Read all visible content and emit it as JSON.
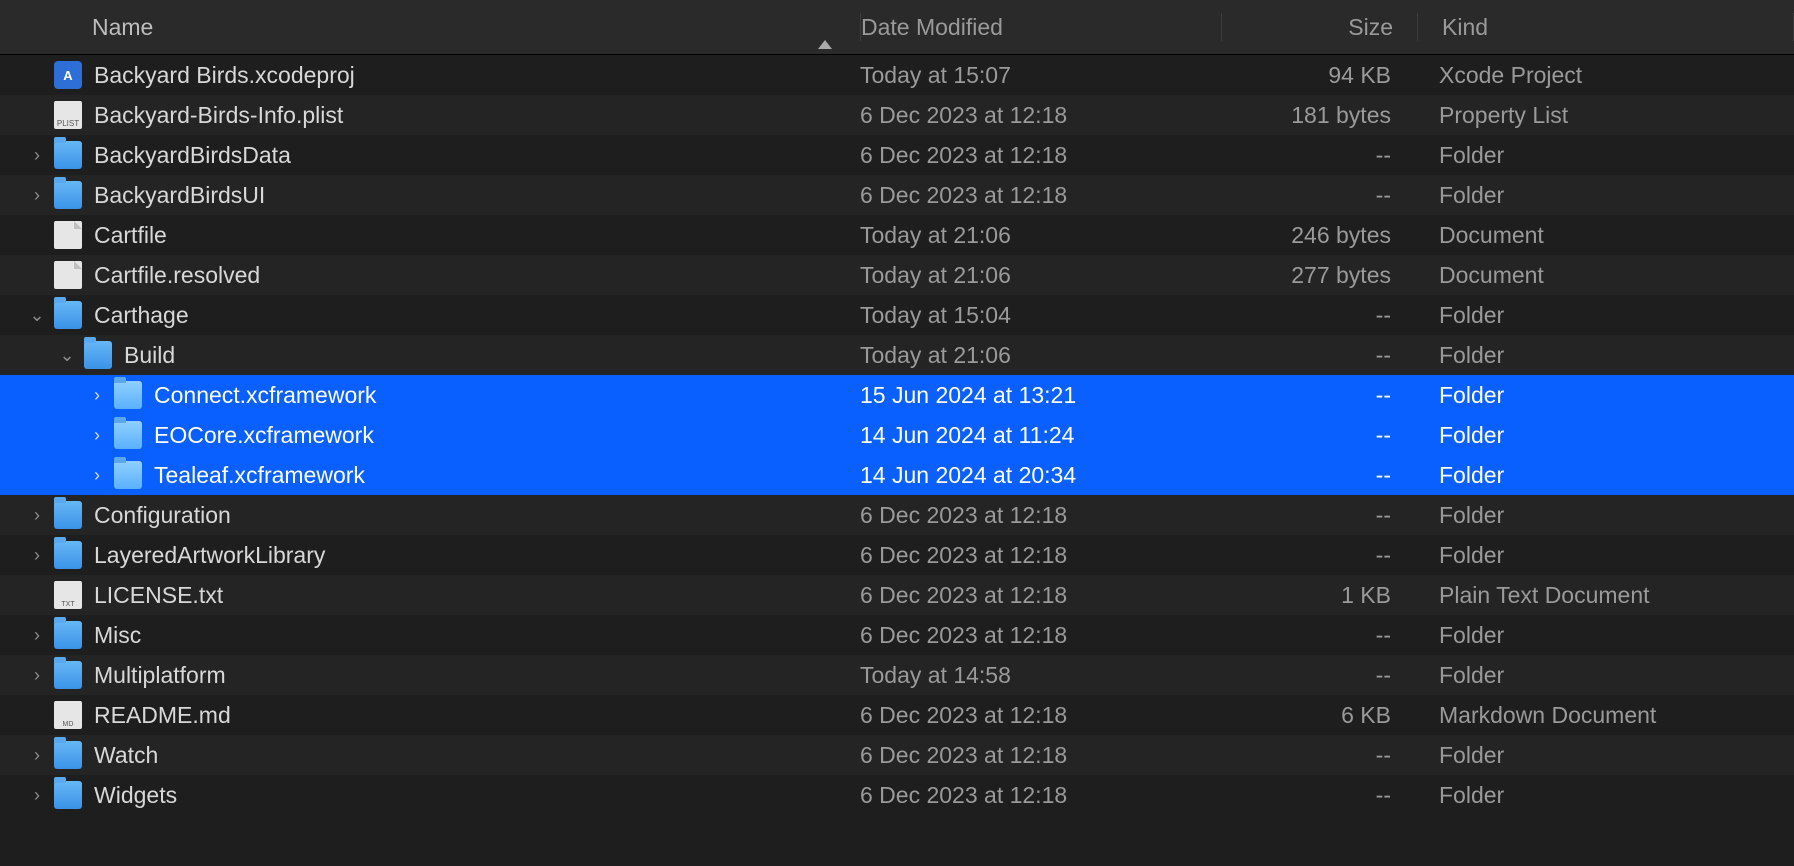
{
  "columns": {
    "name": "Name",
    "date": "Date Modified",
    "size": "Size",
    "kind": "Kind"
  },
  "rows": [
    {
      "indent": 0,
      "disclose": "none",
      "icon": "xcode",
      "name": "Backyard Birds.xcodeproj",
      "date": "Today at 15:07",
      "size": "94 KB",
      "kind": "Xcode Project",
      "selected": false
    },
    {
      "indent": 0,
      "disclose": "none",
      "icon": "plist",
      "name": "Backyard-Birds-Info.plist",
      "date": "6 Dec 2023 at 12:18",
      "size": "181 bytes",
      "kind": "Property List",
      "selected": false
    },
    {
      "indent": 0,
      "disclose": "right",
      "icon": "folder",
      "name": "BackyardBirdsData",
      "date": "6 Dec 2023 at 12:18",
      "size": "--",
      "kind": "Folder",
      "selected": false
    },
    {
      "indent": 0,
      "disclose": "right",
      "icon": "folder",
      "name": "BackyardBirdsUI",
      "date": "6 Dec 2023 at 12:18",
      "size": "--",
      "kind": "Folder",
      "selected": false
    },
    {
      "indent": 0,
      "disclose": "none",
      "icon": "file",
      "name": "Cartfile",
      "date": "Today at 21:06",
      "size": "246 bytes",
      "kind": "Document",
      "selected": false
    },
    {
      "indent": 0,
      "disclose": "none",
      "icon": "file",
      "name": "Cartfile.resolved",
      "date": "Today at 21:06",
      "size": "277 bytes",
      "kind": "Document",
      "selected": false
    },
    {
      "indent": 0,
      "disclose": "down",
      "icon": "folder",
      "name": "Carthage",
      "date": "Today at 15:04",
      "size": "--",
      "kind": "Folder",
      "selected": false
    },
    {
      "indent": 1,
      "disclose": "down",
      "icon": "folder",
      "name": "Build",
      "date": "Today at 21:06",
      "size": "--",
      "kind": "Folder",
      "selected": false
    },
    {
      "indent": 2,
      "disclose": "right",
      "icon": "folder",
      "name": "Connect.xcframework",
      "date": "15 Jun 2024 at 13:21",
      "size": "--",
      "kind": "Folder",
      "selected": true
    },
    {
      "indent": 2,
      "disclose": "right",
      "icon": "folder",
      "name": "EOCore.xcframework",
      "date": "14 Jun 2024 at 11:24",
      "size": "--",
      "kind": "Folder",
      "selected": true
    },
    {
      "indent": 2,
      "disclose": "right",
      "icon": "folder",
      "name": "Tealeaf.xcframework",
      "date": "14 Jun 2024 at 20:34",
      "size": "--",
      "kind": "Folder",
      "selected": true
    },
    {
      "indent": 0,
      "disclose": "right",
      "icon": "folder",
      "name": "Configuration",
      "date": "6 Dec 2023 at 12:18",
      "size": "--",
      "kind": "Folder",
      "selected": false
    },
    {
      "indent": 0,
      "disclose": "right",
      "icon": "folder",
      "name": "LayeredArtworkLibrary",
      "date": "6 Dec 2023 at 12:18",
      "size": "--",
      "kind": "Folder",
      "selected": false
    },
    {
      "indent": 0,
      "disclose": "none",
      "icon": "txt",
      "name": "LICENSE.txt",
      "date": "6 Dec 2023 at 12:18",
      "size": "1 KB",
      "kind": "Plain Text Document",
      "selected": false
    },
    {
      "indent": 0,
      "disclose": "right",
      "icon": "folder",
      "name": "Misc",
      "date": "6 Dec 2023 at 12:18",
      "size": "--",
      "kind": "Folder",
      "selected": false
    },
    {
      "indent": 0,
      "disclose": "right",
      "icon": "folder",
      "name": "Multiplatform",
      "date": "Today at 14:58",
      "size": "--",
      "kind": "Folder",
      "selected": false
    },
    {
      "indent": 0,
      "disclose": "none",
      "icon": "md",
      "name": "README.md",
      "date": "6 Dec 2023 at 12:18",
      "size": "6 KB",
      "kind": "Markdown Document",
      "selected": false
    },
    {
      "indent": 0,
      "disclose": "right",
      "icon": "folder",
      "name": "Watch",
      "date": "6 Dec 2023 at 12:18",
      "size": "--",
      "kind": "Folder",
      "selected": false
    },
    {
      "indent": 0,
      "disclose": "right",
      "icon": "folder",
      "name": "Widgets",
      "date": "6 Dec 2023 at 12:18",
      "size": "--",
      "kind": "Folder",
      "selected": false
    }
  ]
}
